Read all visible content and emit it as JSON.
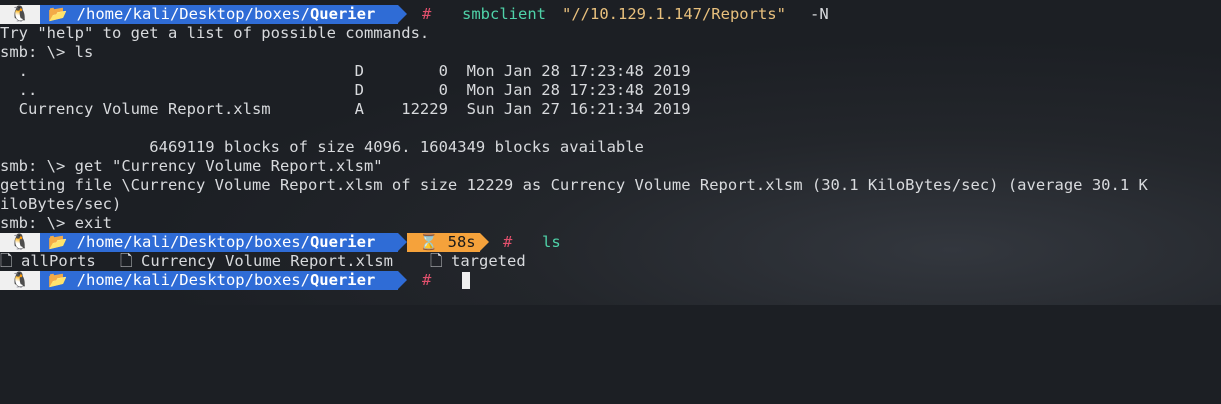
{
  "prompts": [
    {
      "root_icon": "🐧",
      "home_icon": "📂",
      "path_prefix": "/home/kali/Desktop/boxes/",
      "path_bold": "Querier",
      "hash": "#",
      "command": "smbclient",
      "arg_string": "\"//10.129.1.147/Reports\"",
      "arg_flag": "-N"
    },
    {
      "root_icon": "🐧",
      "home_icon": "📂",
      "path_prefix": "/home/kali/Desktop/boxes/",
      "path_bold": "Querier",
      "duration": "⌛ 58s",
      "hash": "#",
      "command": "ls"
    },
    {
      "root_icon": "🐧",
      "home_icon": "📂",
      "path_prefix": "/home/kali/Desktop/boxes/",
      "path_bold": "Querier",
      "hash": "#"
    }
  ],
  "output": {
    "help_line": "Try \"help\" to get a list of possible commands.",
    "smb_ls": "smb: \\> ls",
    "dir_rows": [
      "  .                                   D        0  Mon Jan 28 17:23:48 2019",
      "  ..                                  D        0  Mon Jan 28 17:23:48 2019",
      "  Currency Volume Report.xlsm         A    12229  Sun Jan 27 16:21:34 2019"
    ],
    "blocks_line": "                6469119 blocks of size 4096. 1604349 blocks available",
    "smb_get": "smb: \\> get \"Currency Volume Report.xlsm\"",
    "getting_line1": "getting file \\Currency Volume Report.xlsm of size 12229 as Currency Volume Report.xlsm (30.1 KiloBytes/sec) (average 30.1 K",
    "getting_line2": "iloBytes/sec)",
    "smb_exit": "smb: \\> exit",
    "ls_files": [
      "allPorts",
      "Currency Volume Report.xlsm",
      "targeted"
    ],
    "file_icon": "🗋"
  },
  "colors": {
    "background": "#1c1f24",
    "path_segment": "#2f6cd6",
    "time_segment": "#f5a23b",
    "hash": "#e0506c",
    "command": "#4fd2a8",
    "string": "#e8c07d"
  }
}
